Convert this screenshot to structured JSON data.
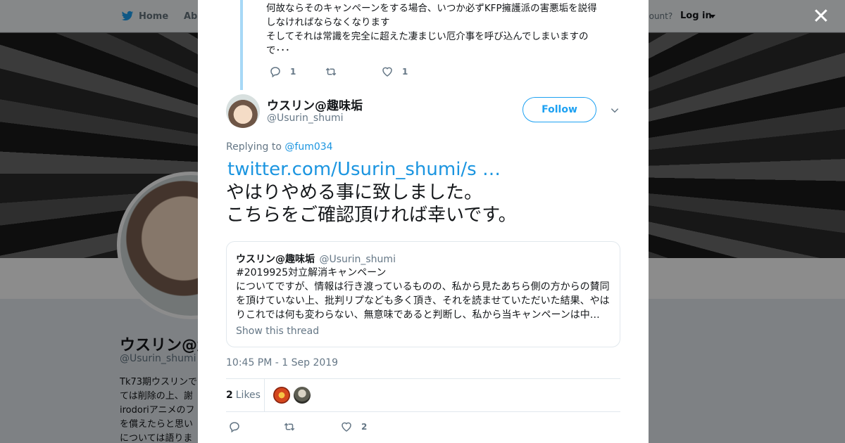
{
  "nav": {
    "home_label": "Home",
    "about_label": "Abo",
    "account_prompt": "count?",
    "login_label": "Log in"
  },
  "background_profile": {
    "name": "ウスリン@趣",
    "handle": "@Usurin_shumi",
    "bio_lines": [
      "Tk73期ウスリンで",
      "ては削除の上、謝",
      "irodoriアニメのフ",
      "を償えたらと思い",
      "については語りま"
    ]
  },
  "previous_tweet": {
    "lines": [
      "何故ならそのキャンペーンをする場合、いつか必ずKFP擁護派の害悪垢を説得",
      "しなければならなくなります",
      "そしてそれは常識を完全に超えた凄まじい厄介事を呼び込んでしまいますの",
      "で･･･"
    ],
    "reply_count": "1",
    "like_count": "1"
  },
  "tweet": {
    "author_name": "ウスリン@趣味垢",
    "author_handle": "@Usurin_shumi",
    "follow_label": "Follow",
    "replying_prefix": "Replying to",
    "replying_to": "@fum034",
    "link_text": "twitter.com/Usurin_shumi/s …",
    "text_lines": [
      "やはりやめる事に致しました。",
      "こちらをご確認頂ければ幸いです。"
    ],
    "timestamp": "10:45 PM - 1 Sep 2019",
    "likes_count": "2",
    "likes_label": "Likes",
    "footer_like_count": "2"
  },
  "quoted_tweet": {
    "name": "ウスリン@趣味垢",
    "handle": "@Usurin_shumi",
    "lines": [
      "#2019925対立解消キャンペーン",
      "についてですが、情報は行き渡っているものの、私から見たあちら側の方からの賛同",
      "を頂けていない上、批判リプなども多く頂き、それを読ませていただいた結果、やは",
      "りこれでは何も変わらない、無意味であると判断し、私から当キャンペーンは中…"
    ],
    "show_thread_label": "Show this thread"
  },
  "colors": {
    "accent": "#1da1f2",
    "link": "#1b95e0",
    "thread_line": "#a7d8f6",
    "secondary_text": "#657786"
  },
  "icons": [
    "twitter-bird-icon",
    "close-icon",
    "reply-icon",
    "retweet-icon",
    "heart-icon",
    "chevron-down-icon"
  ]
}
